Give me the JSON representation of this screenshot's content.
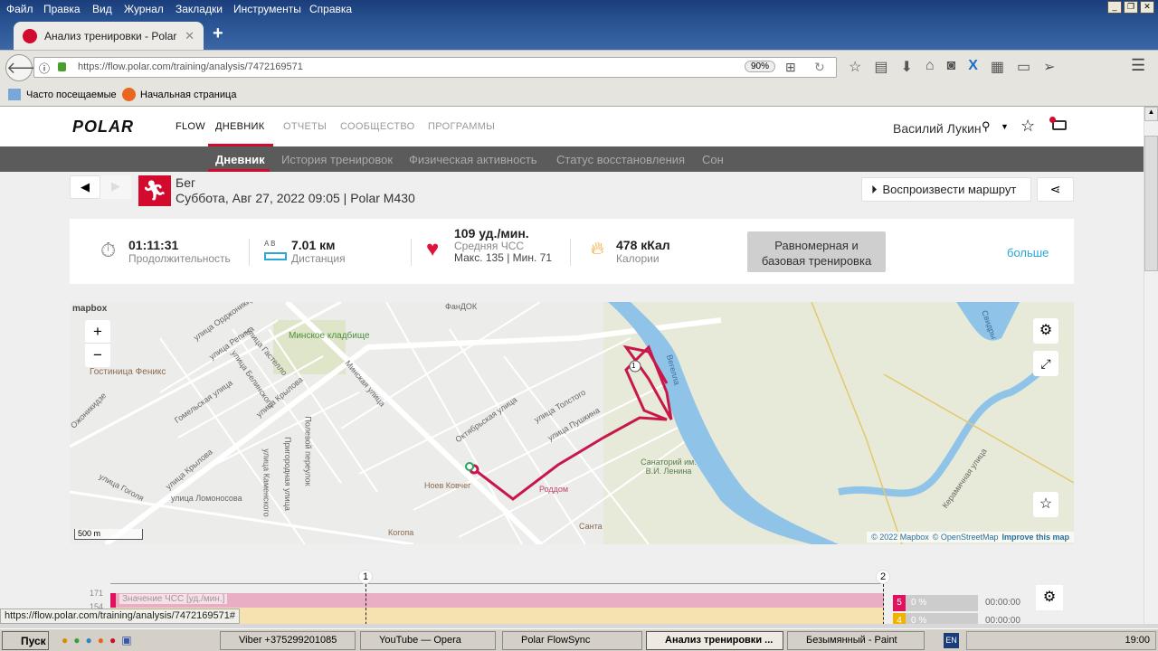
{
  "browser": {
    "menu": [
      "Файл",
      "Правка",
      "Вид",
      "Журнал",
      "Закладки",
      "Инструменты",
      "Справка"
    ],
    "tab_title": "Анализ тренировки - Polar F...",
    "url": "https://flow.polar.com/training/analysis/7472169571",
    "zoom": "90%",
    "bookmarks": [
      "Часто посещаемые",
      "Начальная страница"
    ],
    "status_url": "https://flow.polar.com/training/analysis/7472169571#"
  },
  "polar": {
    "logo": "POLAR",
    "nav": [
      "FLOW",
      "ДНЕВНИК",
      "ОТЧЕТЫ",
      "СООБЩЕСТВО",
      "ПРОГРАММЫ"
    ],
    "user": "Василий Лукин",
    "subnav": [
      "Дневник",
      "История тренировок",
      "Физическая активность",
      "Статус восстановления",
      "Сон"
    ]
  },
  "training": {
    "sport": "Бег",
    "datetime": "Суббота, Авг 27, 2022 09:05 | Polar M430",
    "replay_label": "Воспроизвести маршрут",
    "duration": "01:11:31",
    "duration_label": "Продолжительность",
    "distance_ab": "A   B",
    "distance": "7.01 км",
    "distance_label": "Дистанция",
    "hr": "109 уд./мин.",
    "hr_label": "Средняя ЧСС",
    "hr_minmax": "Макс. 135  |  Мин. 71",
    "calories": "478 кКал",
    "calories_label": "Калории",
    "benefit": "Равномерная и базовая тренировка",
    "more": "больше"
  },
  "map": {
    "attribution_logo": "mapbox",
    "scale": "500 m",
    "copyright": "© 2022 Mapbox",
    "osm": "© OpenStreetMap",
    "improve": "Improve this map",
    "lap_marker": "1",
    "labels": [
      "Минское кладбище",
      "Гостиница Феникс",
      "улица Орджоникидзе",
      "улица Репина",
      "улица Гастелло",
      "улица Белинского",
      "Гомельская улица",
      "улица Крылова",
      "улица Крылова",
      "Минская улица",
      "Полевой переулок",
      "Пригородная улица",
      "улица Каменского",
      "улица Ломоносова",
      "улица Гоголя",
      "Октябрьская улица",
      "улица Толстого",
      "улица Пушкина",
      "Ноев Ковчег",
      "Роддом",
      "Когопа",
      "Санта",
      "Санаторий им. В.И. Ленина",
      "Вегелла",
      "Свидры",
      "Керамичная улица",
      "ФанДОК",
      "Ожоникидзе"
    ]
  },
  "chart": {
    "y_ticks": [
      "171",
      "154"
    ],
    "series_label": "Значение ЧСС [уд./мин.]",
    "laps": [
      "1",
      "2"
    ],
    "zones": [
      {
        "zone": "5",
        "pct": "0 %",
        "time": "00:00:00",
        "color": "#e0125f"
      },
      {
        "zone": "4",
        "pct": "0 %",
        "time": "00:00:00",
        "color": "#f0b400"
      }
    ]
  },
  "taskbar": {
    "start": "Пуск",
    "items": [
      "Viber +375299201085",
      "YouTube — Opera",
      "Polar FlowSync",
      "Анализ тренировки ...",
      "Безымянный - Paint"
    ],
    "lang": "EN",
    "clock": "19:00"
  },
  "colors": {
    "accent": "#d10a2e",
    "route": "#c8174a",
    "link": "#27a6d6"
  }
}
